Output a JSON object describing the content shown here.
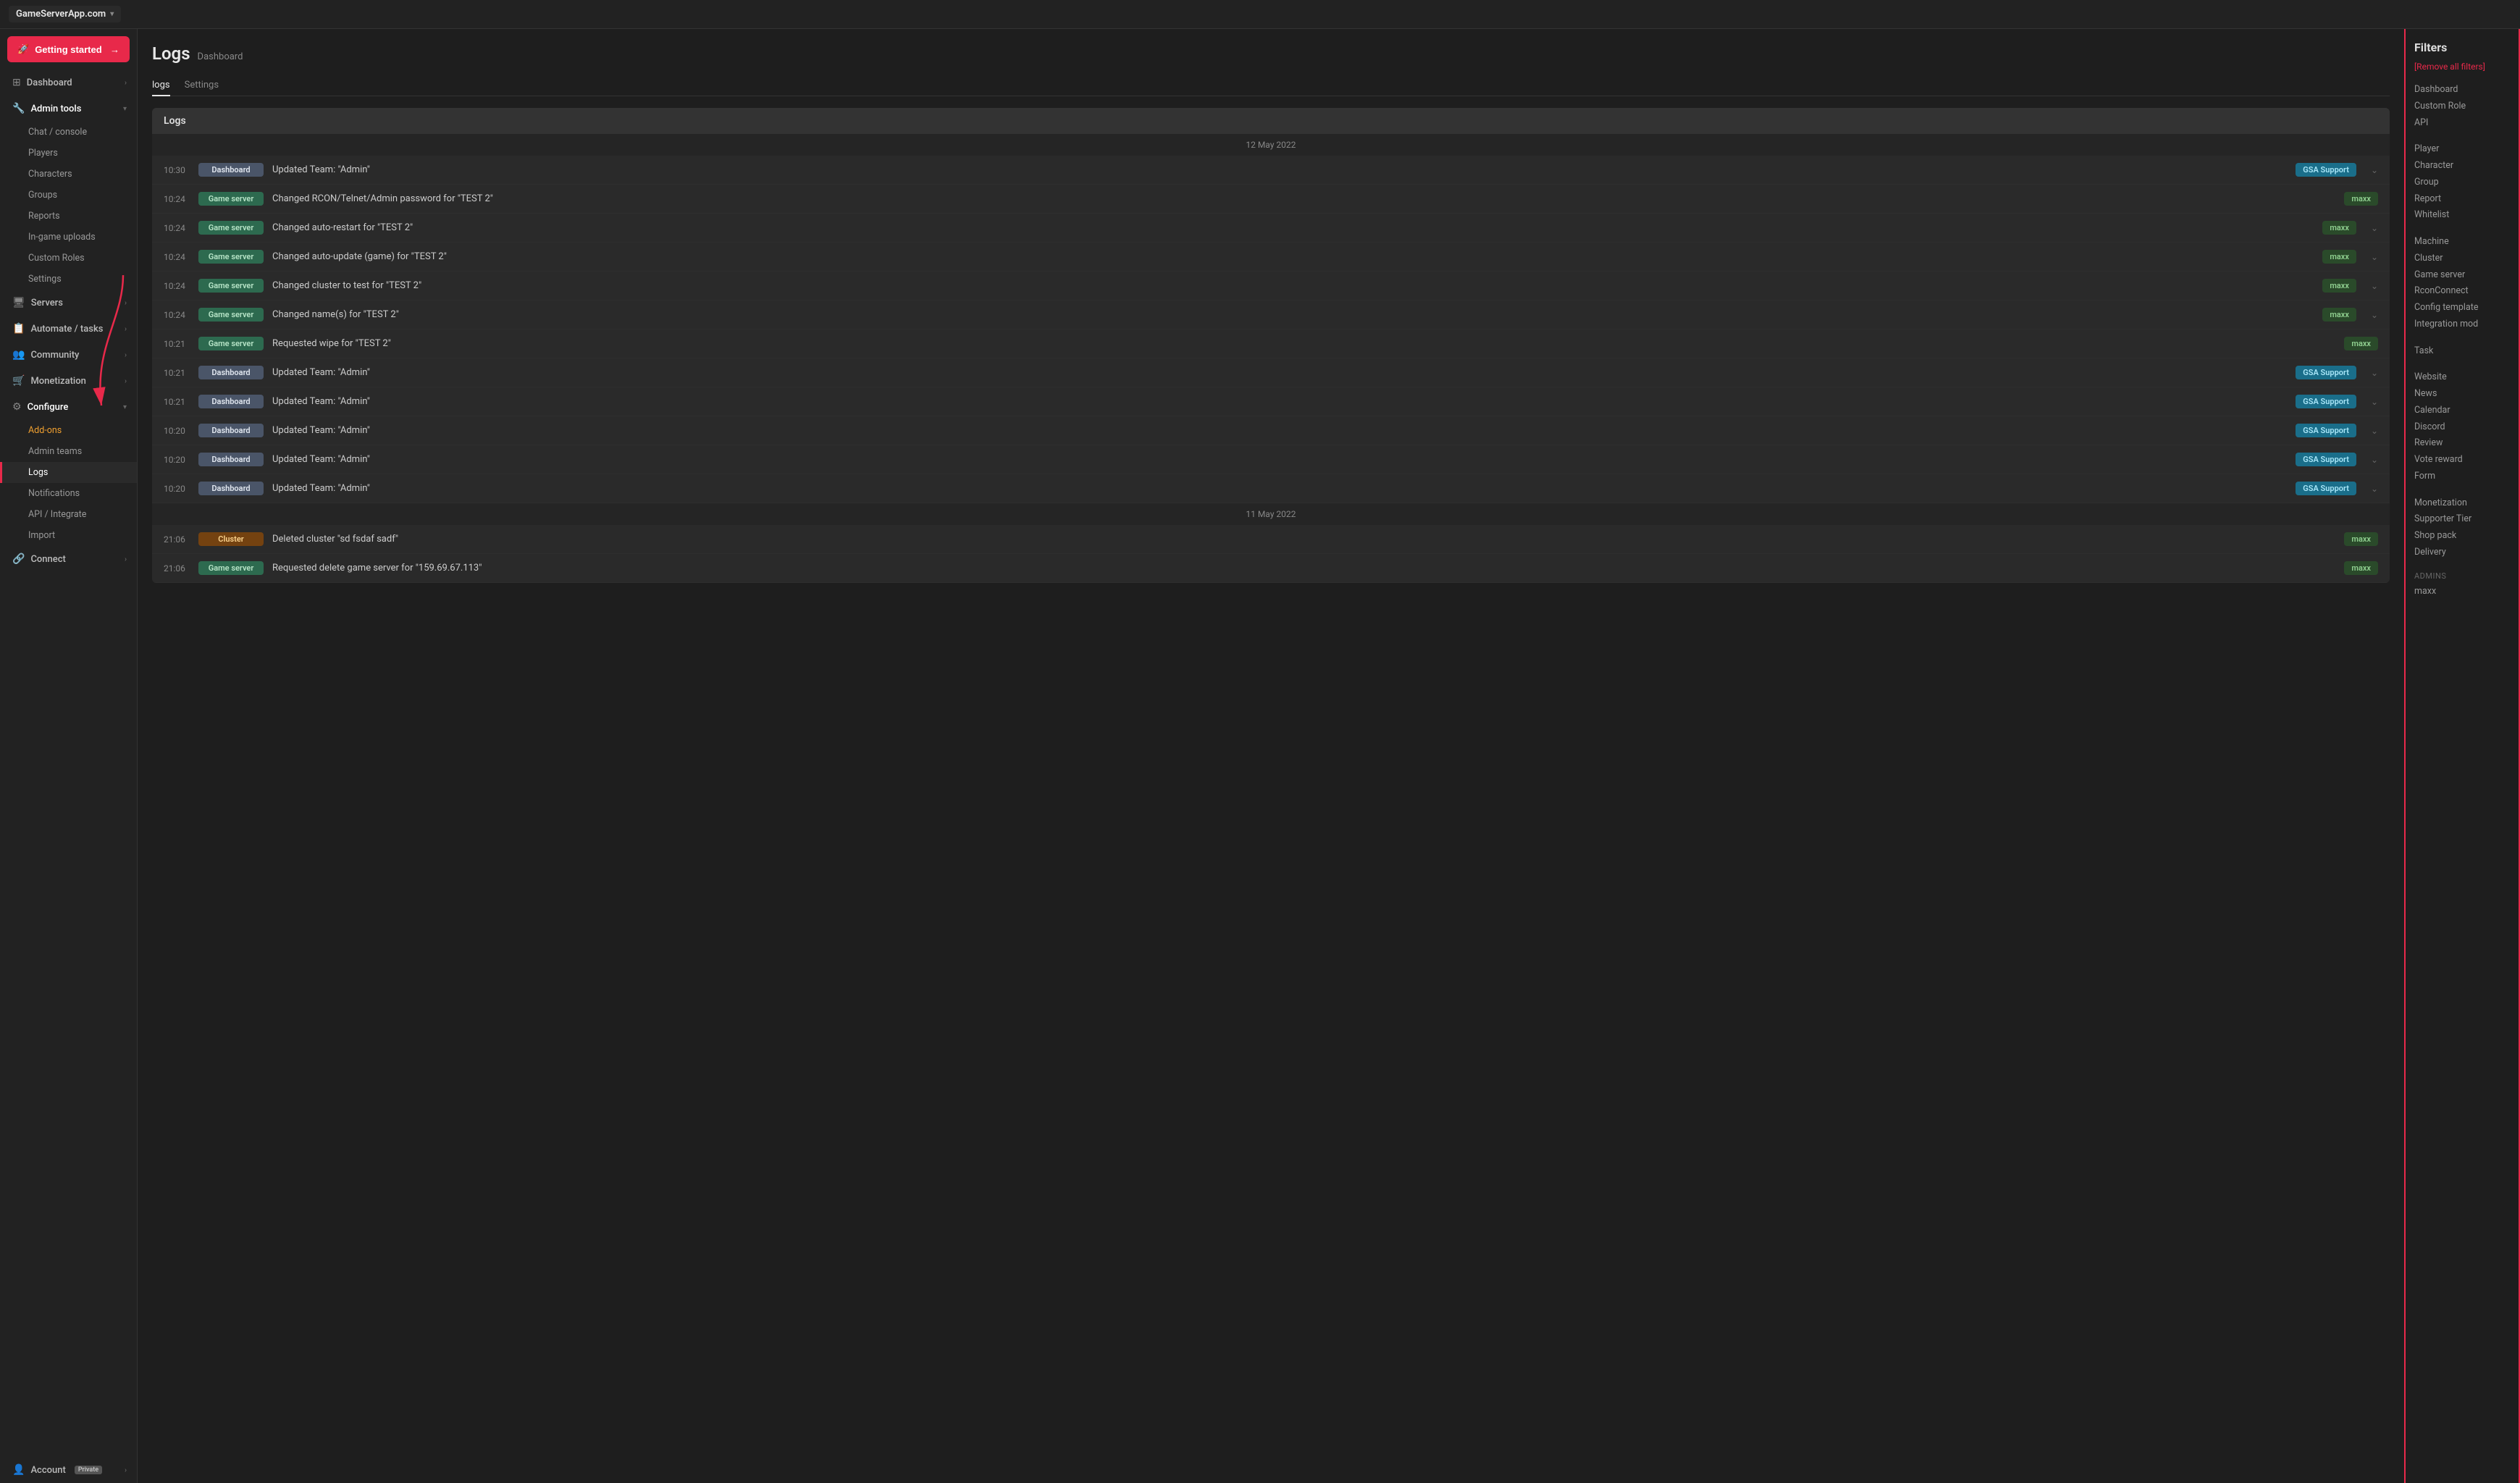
{
  "app": {
    "title": "GameServerApp.com",
    "title_arrow": "▾"
  },
  "getting_started": {
    "label": "Getting started",
    "arrow": "→"
  },
  "sidebar": {
    "dashboard": {
      "label": "Dashboard",
      "icon": "⊞"
    },
    "admin_tools": {
      "label": "Admin tools",
      "icon": "🔧"
    },
    "sub_admin": [
      {
        "label": "Chat / console",
        "active": false
      },
      {
        "label": "Players",
        "active": false
      },
      {
        "label": "Characters",
        "active": false
      },
      {
        "label": "Groups",
        "active": false
      },
      {
        "label": "Reports",
        "active": false
      },
      {
        "label": "In-game uploads",
        "active": false
      },
      {
        "label": "Custom Roles",
        "active": false
      },
      {
        "label": "Settings",
        "active": false
      }
    ],
    "servers": {
      "label": "Servers",
      "icon": "🖥"
    },
    "automate_tasks": {
      "label": "Automate / tasks",
      "icon": "📋"
    },
    "community": {
      "label": "Community",
      "icon": "👥"
    },
    "monetization": {
      "label": "Monetization",
      "icon": "🛒"
    },
    "configure": {
      "label": "Configure",
      "icon": "⚙"
    },
    "sub_configure": [
      {
        "label": "Add-ons",
        "active": false,
        "highlight": true
      },
      {
        "label": "Admin teams",
        "active": false
      },
      {
        "label": "Logs",
        "active": true
      },
      {
        "label": "Notifications",
        "active": false
      },
      {
        "label": "API / Integrate",
        "active": false
      },
      {
        "label": "Import",
        "active": false
      }
    ],
    "connect": {
      "label": "Connect",
      "icon": "🔗"
    },
    "account": {
      "label": "Account",
      "icon": "👤",
      "badge": "Private"
    }
  },
  "page": {
    "title": "Logs",
    "breadcrumb": "Dashboard",
    "tabs": [
      "logs",
      "Settings"
    ],
    "active_tab": "logs"
  },
  "logs_panel": {
    "title": "Logs",
    "sections": [
      {
        "date": "12 May 2022",
        "entries": [
          {
            "time": "10:30",
            "badge": "Dashboard",
            "badge_type": "dashboard",
            "message": "Updated Team: \"Admin\"",
            "user": "GSA Support",
            "user_type": "gsa",
            "expandable": true
          },
          {
            "time": "10:24",
            "badge": "Game server",
            "badge_type": "gameserver",
            "message": "Changed RCON/Telnet/Admin password for \"TEST 2\"",
            "user": "maxx",
            "user_type": "maxx",
            "expandable": false
          },
          {
            "time": "10:24",
            "badge": "Game server",
            "badge_type": "gameserver",
            "message": "Changed auto-restart for \"TEST 2\"",
            "user": "maxx",
            "user_type": "maxx",
            "expandable": true
          },
          {
            "time": "10:24",
            "badge": "Game server",
            "badge_type": "gameserver",
            "message": "Changed auto-update (game) for \"TEST 2\"",
            "user": "maxx",
            "user_type": "maxx",
            "expandable": true
          },
          {
            "time": "10:24",
            "badge": "Game server",
            "badge_type": "gameserver",
            "message": "Changed cluster to test for \"TEST 2\"",
            "user": "maxx",
            "user_type": "maxx",
            "expandable": true
          },
          {
            "time": "10:24",
            "badge": "Game server",
            "badge_type": "gameserver",
            "message": "Changed name(s) for \"TEST 2\"",
            "user": "maxx",
            "user_type": "maxx",
            "expandable": true
          },
          {
            "time": "10:21",
            "badge": "Game server",
            "badge_type": "gameserver",
            "message": "Requested wipe for \"TEST 2\"",
            "user": "maxx",
            "user_type": "maxx",
            "expandable": false
          },
          {
            "time": "10:21",
            "badge": "Dashboard",
            "badge_type": "dashboard",
            "message": "Updated Team: \"Admin\"",
            "user": "GSA Support",
            "user_type": "gsa",
            "expandable": true
          },
          {
            "time": "10:21",
            "badge": "Dashboard",
            "badge_type": "dashboard",
            "message": "Updated Team: \"Admin\"",
            "user": "GSA Support",
            "user_type": "gsa",
            "expandable": true
          },
          {
            "time": "10:20",
            "badge": "Dashboard",
            "badge_type": "dashboard",
            "message": "Updated Team: \"Admin\"",
            "user": "GSA Support",
            "user_type": "gsa",
            "expandable": true
          },
          {
            "time": "10:20",
            "badge": "Dashboard",
            "badge_type": "dashboard",
            "message": "Updated Team: \"Admin\"",
            "user": "GSA Support",
            "user_type": "gsa",
            "expandable": true
          },
          {
            "time": "10:20",
            "badge": "Dashboard",
            "badge_type": "dashboard",
            "message": "Updated Team: \"Admin\"",
            "user": "GSA Support",
            "user_type": "gsa",
            "expandable": true
          }
        ]
      },
      {
        "date": "11 May 2022",
        "entries": [
          {
            "time": "21:06",
            "badge": "Cluster",
            "badge_type": "cluster",
            "message": "Deleted cluster \"sd fsdaf sadf\"",
            "user": "maxx",
            "user_type": "maxx",
            "expandable": false
          },
          {
            "time": "21:06",
            "badge": "Game server",
            "badge_type": "gameserver",
            "message": "Requested delete game server for \"159.69.67.113\"",
            "user": "maxx",
            "user_type": "maxx",
            "expandable": false
          }
        ]
      }
    ]
  },
  "filters": {
    "title": "Filters",
    "remove_label": "[Remove all filters]",
    "groups": [
      {
        "items": [
          "Dashboard",
          "Custom Role",
          "API"
        ]
      },
      {
        "items": [
          "Player",
          "Character",
          "Group",
          "Report",
          "Whitelist"
        ]
      },
      {
        "items": [
          "Machine",
          "Cluster",
          "Game server",
          "RconConnect",
          "Config template",
          "Integration mod"
        ]
      },
      {
        "items": [
          "Task"
        ]
      },
      {
        "items": [
          "Website",
          "News",
          "Calendar",
          "Discord",
          "Review",
          "Vote reward",
          "Form"
        ]
      },
      {
        "items": [
          "Monetization",
          "Supporter Tier",
          "Shop pack",
          "Delivery"
        ]
      }
    ],
    "admins_section": {
      "title": "Admins",
      "items": [
        "maxx"
      ]
    }
  },
  "custom_role_tooltip": "Custom Role"
}
